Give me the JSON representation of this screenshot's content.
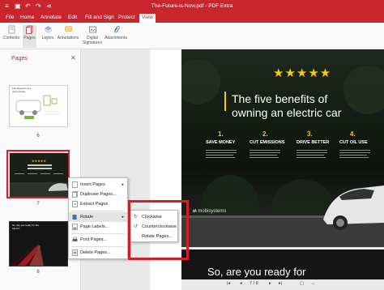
{
  "titlebar": {
    "title": "The-Future-is-Now.pdf - PDF Extra"
  },
  "menu": [
    "File",
    "Home",
    "Annotate",
    "Edit",
    "Fill and Sign",
    "Protect",
    "View"
  ],
  "ribbon": [
    "Contents",
    "Pages",
    "Layers",
    "Annotations",
    "Digital Signatures",
    "Attachments"
  ],
  "panel": {
    "title": "Pages",
    "pages": [
      "6",
      "7",
      "8"
    ]
  },
  "thumb6": {
    "heading": "The blueprint of a green future"
  },
  "thumb8": {
    "heading": "So, are you ready for the future?"
  },
  "context_menu": {
    "items": [
      "Insert Pages",
      "Duplicate Pages...",
      "Extract Pages",
      "Rotate",
      "Page Labels...",
      "Print Pages...",
      "Delete Pages..."
    ]
  },
  "submenu": {
    "items": [
      "Clockwise",
      "Counterclockwise",
      "Rotate Pages..."
    ]
  },
  "slide": {
    "stars": "★★★★★",
    "heading_line1": "The five benefits of",
    "heading_line2": "owning an electric car",
    "benefits": [
      {
        "num": "1.",
        "label": "SAVE MONEY"
      },
      {
        "num": "2.",
        "label": "CUT EMISSIONS"
      },
      {
        "num": "3.",
        "label": "DRIVE BETTER"
      },
      {
        "num": "4.",
        "label": "CUT OIL USE"
      }
    ],
    "brand": "mobisystems"
  },
  "slide2": {
    "heading": "So, are you ready for"
  },
  "bottombar": {
    "page": "7 / 8"
  },
  "colors": {
    "accent": "#c9252c",
    "slide_bg": "#111111",
    "star": "#f5c518",
    "highlight_box": "#d21f26"
  }
}
